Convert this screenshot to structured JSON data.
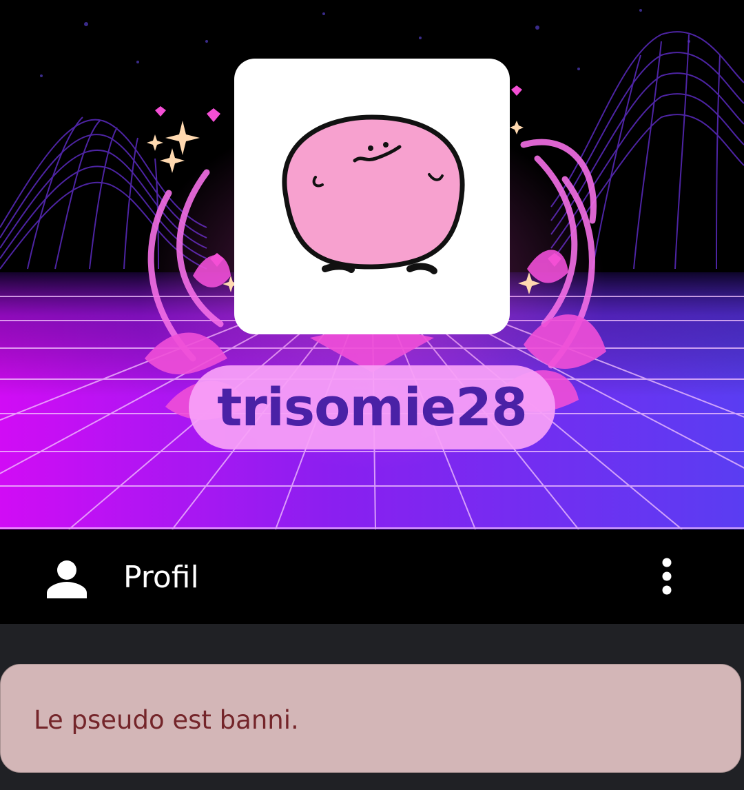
{
  "profile": {
    "username": "trisomie28"
  },
  "header": {
    "title": "Profil",
    "icons": {
      "left": "person-icon",
      "right": "more-vertical-icon"
    }
  },
  "alert": {
    "message": "Le pseudo est banni."
  },
  "colors": {
    "username_text": "#4a21a6",
    "username_pill": "#f7a0f8",
    "alert_background": "#d3b6b7",
    "alert_text": "#74252a",
    "page_background": "#202125",
    "bar_background": "#000000"
  }
}
